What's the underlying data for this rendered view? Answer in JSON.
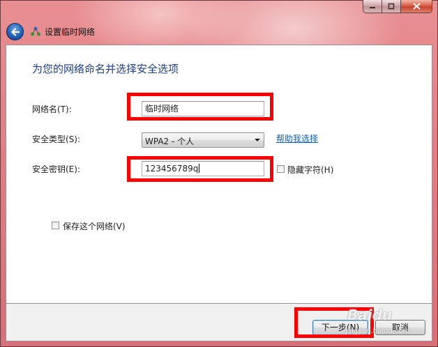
{
  "window": {
    "title": "设置临时网络",
    "caption_buttons": [
      "minimize",
      "maximize",
      "close"
    ]
  },
  "icons": {
    "back": "back-arrow-icon",
    "network": "network-icon"
  },
  "heading": "为您的网络命名并选择安全选项",
  "form": {
    "network_name_label": "网络名(T):",
    "network_name_value": "临时网络",
    "security_type_label": "安全类型(S):",
    "security_type_value": "WPA2 - 个人",
    "help_link": "帮助我选择",
    "security_key_label": "安全密钥(E):",
    "security_key_value": "123456789q",
    "hide_chars_label": "隐藏字符(H)",
    "hide_chars_checked": false,
    "save_network_label": "保存这个网络(V)",
    "save_network_checked": false
  },
  "buttons": {
    "next": "下一步(N)",
    "cancel": "取消"
  },
  "colors": {
    "highlight": "#ff0000",
    "heading": "#1a3e8c",
    "link": "#0b61c6",
    "glass": "#e37f84"
  }
}
